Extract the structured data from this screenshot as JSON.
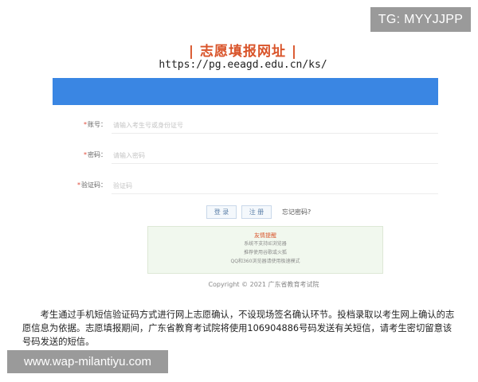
{
  "badge": {
    "tg": "TG: MYYJJPP"
  },
  "portal": {
    "title": "| 志愿填报网址 |",
    "url": "https://pg.eeagd.edu.cn/ks/"
  },
  "form": {
    "account": {
      "star": "*",
      "label": "账号：",
      "placeholder": "请输入考生号或身份证号"
    },
    "password": {
      "star": "*",
      "label": "密码：",
      "placeholder": "请输入密码"
    },
    "captcha": {
      "star": "*",
      "label": "验证码：",
      "placeholder": "验证码"
    },
    "login_label": "登 录",
    "register_label": "注 册",
    "forgot_label": "忘记密码?"
  },
  "notice": {
    "title": "友情提醒",
    "lines": [
      "系统不支持IE浏览器",
      "推荐使用谷歌或火狐",
      "QQ和360浏览器请使用极速模式"
    ]
  },
  "copyright": "Copyright © 2021 广东省教育考试院",
  "article": "考生通过手机短信验证码方式进行网上志愿确认，不设现场签名确认环节。投档录取以考生网上确认的志愿信息为依据。志愿填报期间，广东省教育考试院将使用106904886号码发送有关短信，请考生密切留意该号码发送的短信。",
  "watermark": "www.wap-milantiyu.com",
  "colors": {
    "accent_blue": "#3a86e3",
    "title_red": "#d9542a",
    "notice_bg": "#f1f8ee"
  }
}
